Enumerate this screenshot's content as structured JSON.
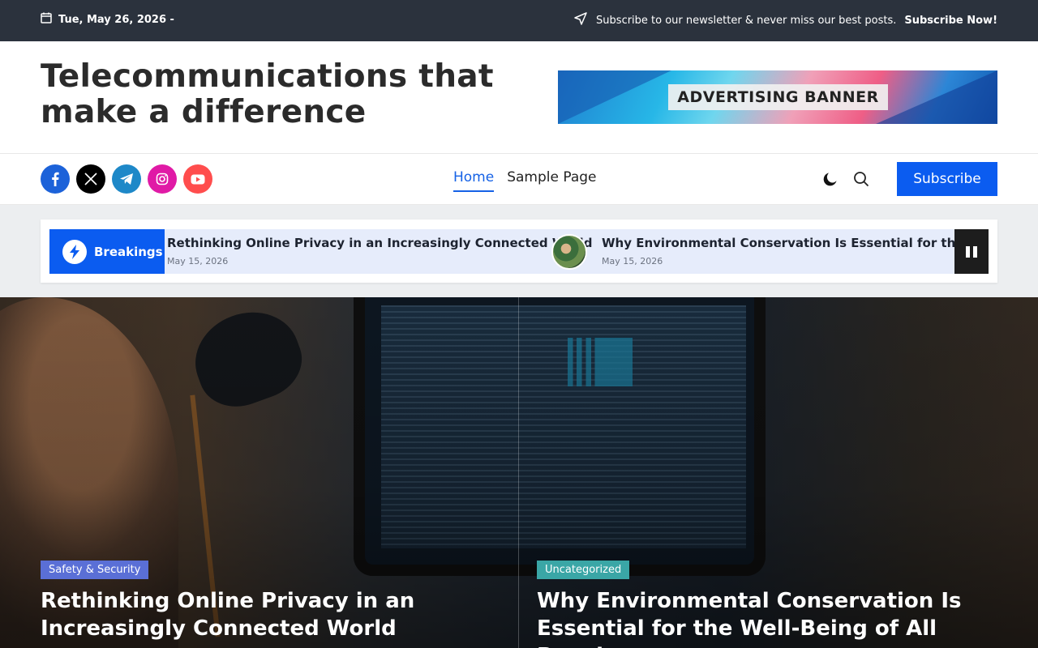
{
  "topbar": {
    "date": "Tue, May 26, 2026 -",
    "newsletter_text": "Subscribe to our newsletter & never miss our best posts.",
    "newsletter_link": "Subscribe Now!"
  },
  "header": {
    "site_title": "Telecommunications that make a difference",
    "ad_banner_text": "ADVERTISING BANNER"
  },
  "nav": {
    "menu": [
      {
        "label": "Home",
        "active": true
      },
      {
        "label": "Sample Page",
        "active": false
      }
    ],
    "subscribe_label": "Subscribe",
    "socials": [
      "facebook-icon",
      "x-icon",
      "telegram-icon",
      "instagram-icon",
      "youtube-icon"
    ]
  },
  "breaking": {
    "label": "Breakings",
    "items": [
      {
        "title": "Rethinking Online Privacy in an Increasingly Connected World",
        "date": "May 15, 2026"
      },
      {
        "title": "Why Environmental Conservation Is Essential for the Well-Being of All People",
        "date": "May 15, 2026"
      }
    ]
  },
  "hero": {
    "posts": [
      {
        "category": "Safety & Security",
        "category_color": "#5a6fd6",
        "title": "Rethinking Online Privacy in an Increasingly Connected World"
      },
      {
        "category": "Uncategorized",
        "category_color": "#3aa6a6",
        "title": "Why Environmental Conservation Is Essential for the Well-Being of All People"
      }
    ]
  },
  "colors": {
    "accent": "#0b5cf0",
    "topbar_bg": "#2b323d"
  }
}
